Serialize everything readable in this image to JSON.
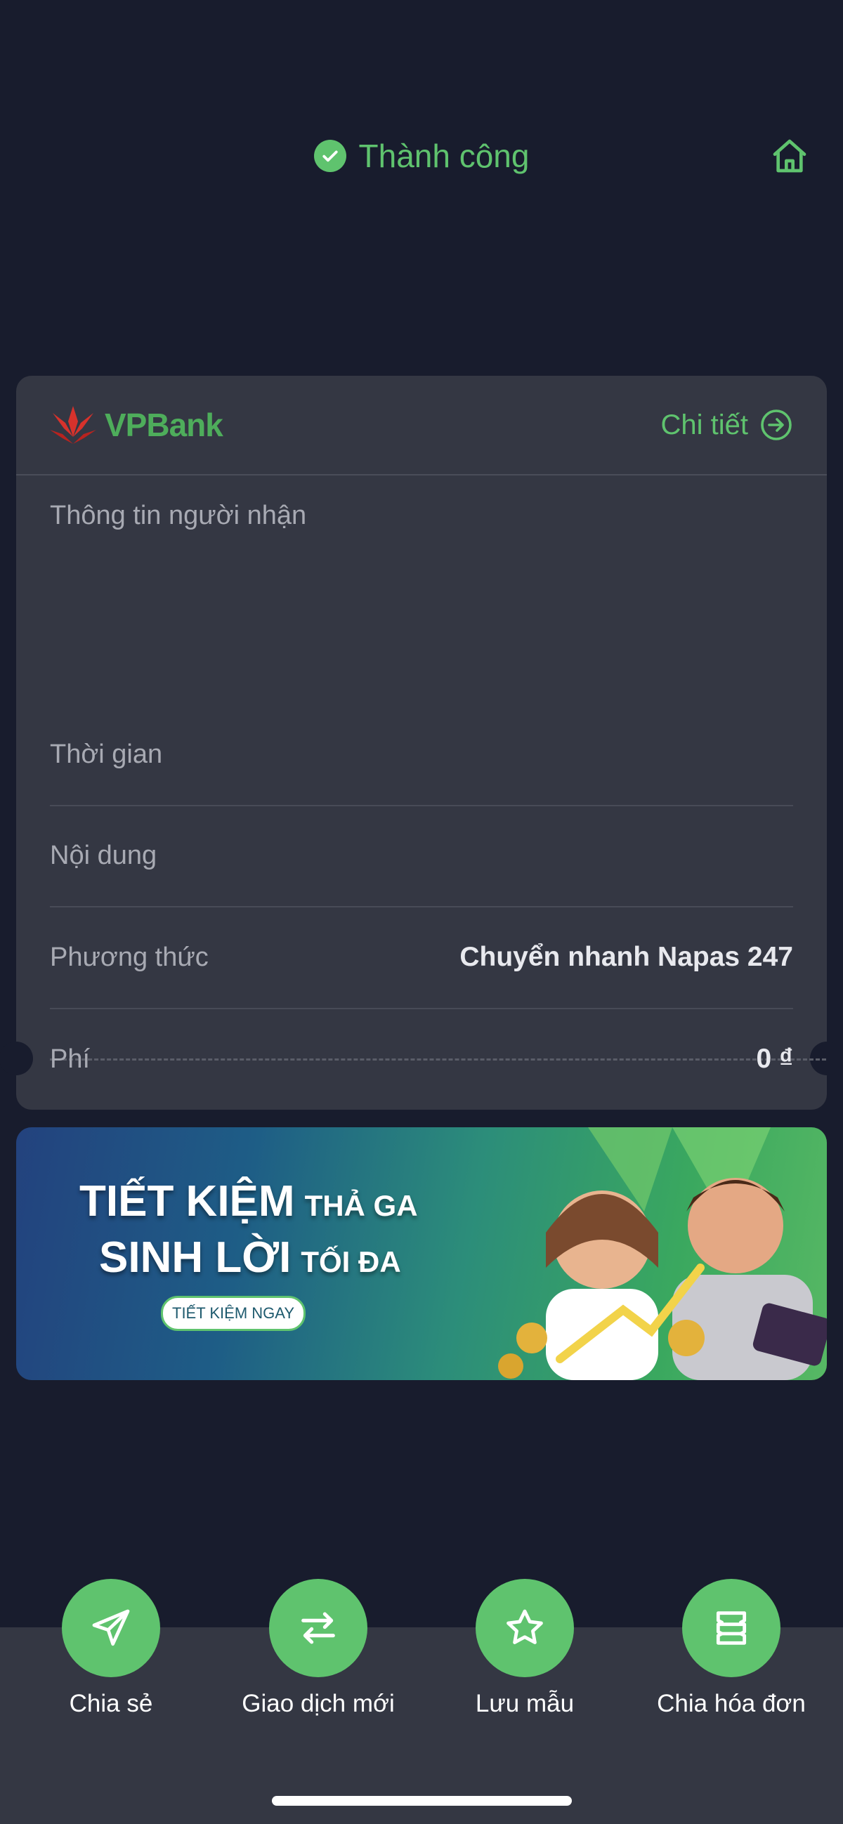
{
  "header": {
    "status_text": "Thành công",
    "status_icon": "check-circle-icon",
    "home_icon": "home-icon"
  },
  "receipt": {
    "bank_name": "VPBank",
    "detail_label": "Chi tiết",
    "recipient_label": "Thông tin người nhận",
    "rows": [
      {
        "label": "Thời gian",
        "value": ""
      },
      {
        "label": "Nội dung",
        "value": ""
      },
      {
        "label": "Phương thức",
        "value": "Chuyển nhanh Napas 247"
      },
      {
        "label": "Phí",
        "value": "0 ₫"
      }
    ]
  },
  "banner": {
    "line1_big": "TIẾT KIỆM",
    "line1_small": "THẢ GA",
    "line2_big": "SINH LỜI",
    "line2_small": "TỐI ĐA",
    "cta": "TIẾT KIỆM NGAY"
  },
  "actions": [
    {
      "label": "Chia sẻ",
      "icon": "send-icon"
    },
    {
      "label": "Giao dịch mới",
      "icon": "swap-arrows-icon"
    },
    {
      "label": "Lưu mẫu",
      "icon": "star-icon"
    },
    {
      "label": "Chia hóa đơn",
      "icon": "split-bill-icon"
    }
  ],
  "colors": {
    "background": "#181c2d",
    "card": "#343743",
    "accent_green": "#5fc36e",
    "bank_red": "#d7322c"
  }
}
